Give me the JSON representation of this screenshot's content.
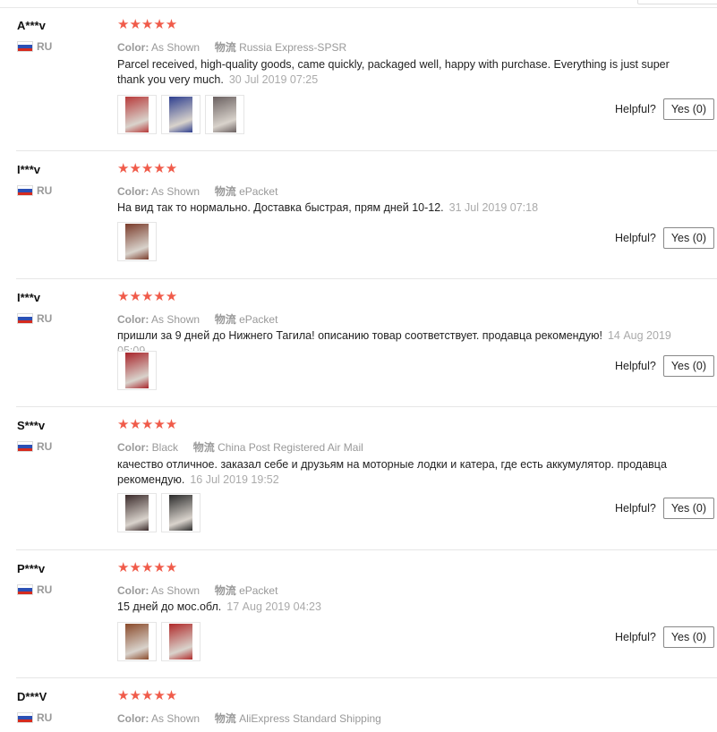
{
  "helpful_label": "Helpful?",
  "color_label": "Color:",
  "logistics_label": "物流",
  "reviews": [
    {
      "user": "A***v",
      "country": "RU",
      "stars": "★★★★★",
      "color": "As Shown",
      "logistics": "Russia Express-SPSR",
      "text": "Parcel received, high-quality goods, came quickly, packaged well, happy with purchase. Everything is just super thank you very much.",
      "date": "30 Jul 2019 07:25",
      "yes": "Yes (0)",
      "photos": [
        "#b73a3a",
        "#2e3f8f",
        "#6a6060"
      ]
    },
    {
      "user": "I***v",
      "country": "RU",
      "stars": "★★★★★",
      "color": "As Shown",
      "logistics": "ePacket",
      "text": "На вид так то нормально. Доставка быстрая, прям дней 10-12.",
      "date": "31 Jul 2019 07:18",
      "yes": "Yes (0)",
      "photos": [
        "#7a3b2a"
      ]
    },
    {
      "user": "I***v",
      "country": "RU",
      "stars": "★★★★★",
      "color": "As Shown",
      "logistics": "ePacket",
      "text": "пришли за 9 дней до Нижнего Тагила! описанию товар соответствует. продавца рекомендую!",
      "date": "14 Aug 2019 05:09",
      "yes": "Yes (0)",
      "photos": [
        "#a8242a"
      ]
    },
    {
      "user": "S***v",
      "country": "RU",
      "stars": "★★★★★",
      "color": "Black",
      "logistics": "China Post Registered Air Mail",
      "text": "качество отличное. заказал себе и друзьям на моторные лодки и катера, где есть аккумулятор. продавца рекомендую.",
      "date": "16 Jul 2019 19:52",
      "yes": "Yes (0)",
      "photos": [
        "#3a2a2a",
        "#2a2a2a"
      ]
    },
    {
      "user": "P***v",
      "country": "RU",
      "stars": "★★★★★",
      "color": "As Shown",
      "logistics": "ePacket",
      "text": "15 дней до мос.обл.",
      "date": "17 Aug 2019 04:23",
      "yes": "Yes (0)",
      "photos": [
        "#8a4a2a",
        "#b02a2a"
      ]
    },
    {
      "user": "D***V",
      "country": "RU",
      "stars": "★★★★★",
      "color": "As Shown",
      "logistics": "AliExpress Standard Shipping",
      "text": "",
      "date": "",
      "yes": "",
      "photos": []
    }
  ]
}
